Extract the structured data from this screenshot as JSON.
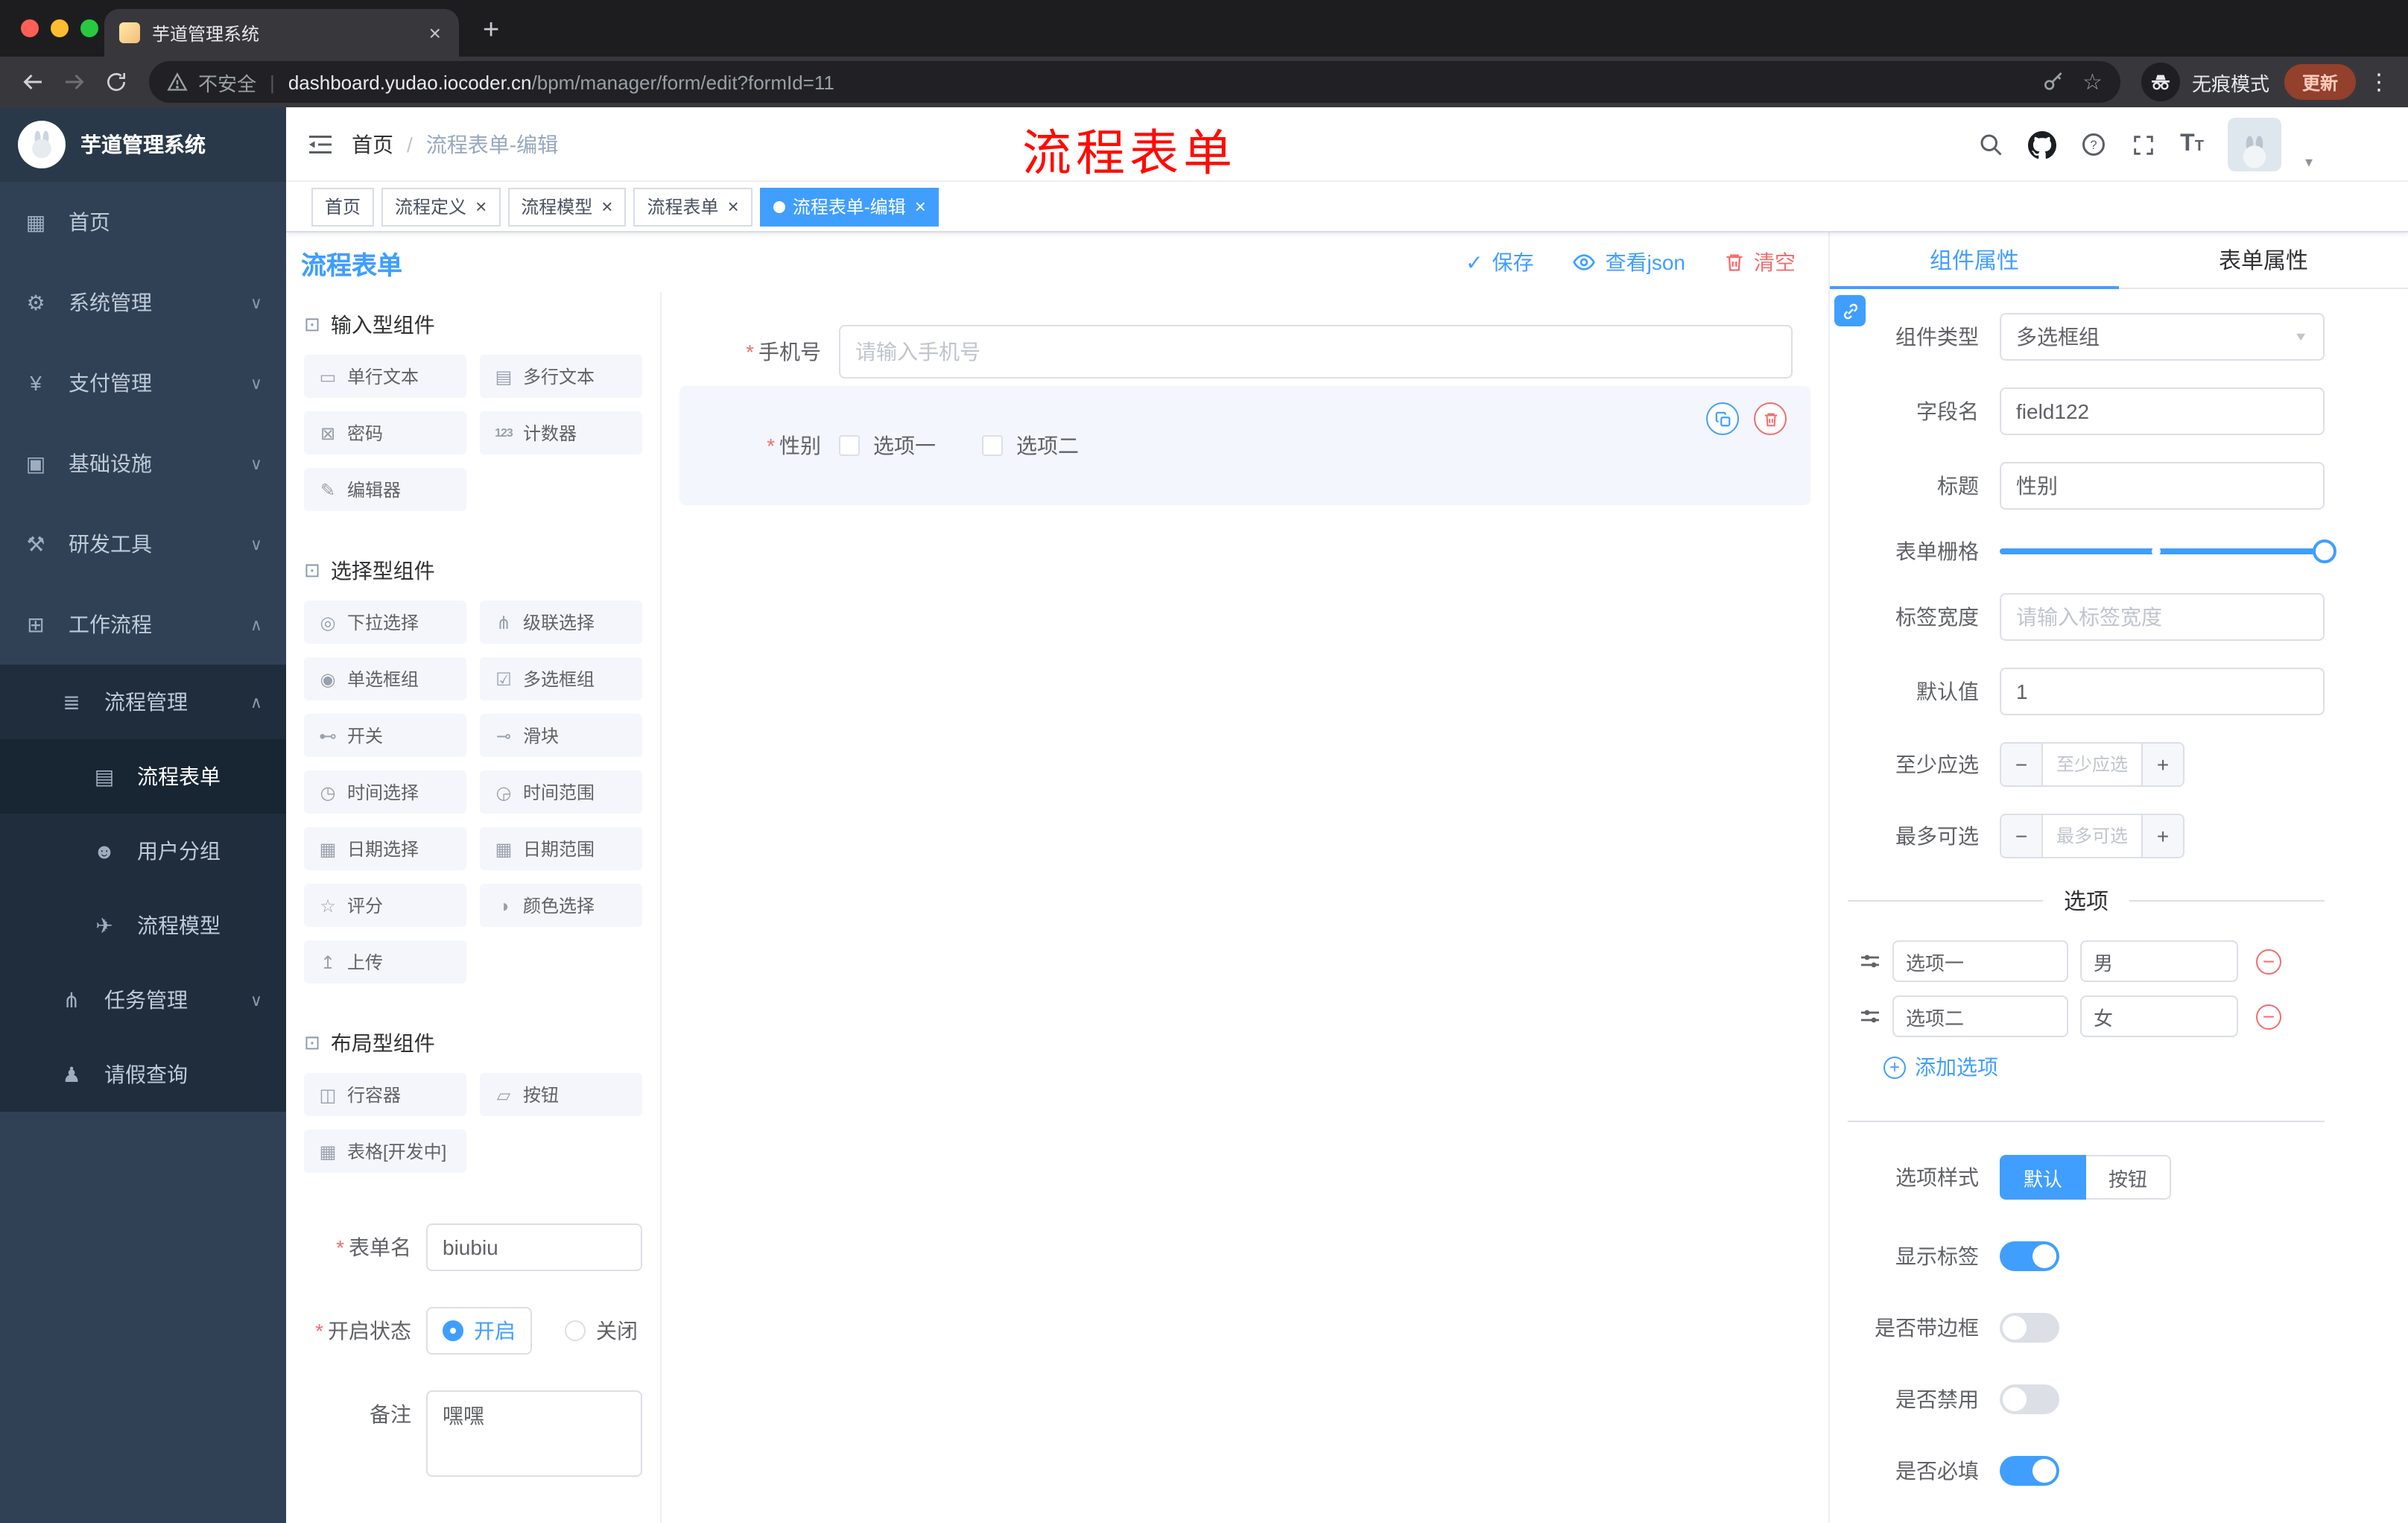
{
  "colors": {
    "accent": "#409EFF",
    "danger": "#F56C6C",
    "annotation_red": "#FF0000",
    "sidebar_bg": "#304156"
  },
  "browser": {
    "tab_title": "芋道管理系统",
    "new_tab": "+",
    "security": "不安全",
    "url_domain": "dashboard.yudao.iocoder.cn",
    "url_path": "/bpm/manager/form/edit?formId=11",
    "incognito": "无痕模式",
    "update": "更新"
  },
  "annotation": "流程表单",
  "sidebar": {
    "brand": "芋道管理系统",
    "menu": [
      {
        "label": "首页",
        "icon": "home",
        "level": 1
      },
      {
        "label": "系统管理",
        "icon": "gear",
        "level": 1,
        "chevron": "down"
      },
      {
        "label": "支付管理",
        "icon": "yen",
        "level": 1,
        "chevron": "down"
      },
      {
        "label": "基础设施",
        "icon": "infra",
        "level": 1,
        "chevron": "down"
      },
      {
        "label": "研发工具",
        "icon": "tools",
        "level": 1,
        "chevron": "down"
      },
      {
        "label": "工作流程",
        "icon": "workflow",
        "level": 1,
        "chevron": "up"
      },
      {
        "label": "流程管理",
        "icon": "list",
        "level": 2,
        "dark": true,
        "chevron": "up"
      },
      {
        "label": "流程表单",
        "icon": "form",
        "level": 3,
        "dark": true,
        "active": true
      },
      {
        "label": "用户分组",
        "icon": "users",
        "level": 3,
        "dark": true
      },
      {
        "label": "流程模型",
        "icon": "send",
        "level": 3,
        "dark": true
      },
      {
        "label": "任务管理",
        "icon": "tree",
        "level": 2,
        "dark": true,
        "chevron": "down"
      },
      {
        "label": "请假查询",
        "icon": "person",
        "level": 2,
        "dark": true
      }
    ]
  },
  "header": {
    "breadcrumb_home": "首页",
    "breadcrumb_sep": "/",
    "breadcrumb_current": "流程表单-编辑"
  },
  "tags": [
    {
      "label": "首页",
      "closable": false,
      "active": false
    },
    {
      "label": "流程定义",
      "closable": true,
      "active": false
    },
    {
      "label": "流程模型",
      "closable": true,
      "active": false
    },
    {
      "label": "流程表单",
      "closable": true,
      "active": false
    },
    {
      "label": "流程表单-编辑",
      "closable": true,
      "active": true
    }
  ],
  "designer": {
    "title": "流程表单",
    "actions": {
      "save": "保存",
      "view_json": "查看json",
      "clear": "清空"
    },
    "palette": [
      {
        "title": "输入型组件",
        "items": [
          {
            "label": "单行文本",
            "icon": "single-line"
          },
          {
            "label": "多行文本",
            "icon": "textarea"
          },
          {
            "label": "密码",
            "icon": "password"
          },
          {
            "label": "计数器",
            "icon": "counter"
          },
          {
            "label": "编辑器",
            "icon": "editor"
          }
        ]
      },
      {
        "title": "选择型组件",
        "items": [
          {
            "label": "下拉选择",
            "icon": "select"
          },
          {
            "label": "级联选择",
            "icon": "cascader"
          },
          {
            "label": "单选框组",
            "icon": "radio-group"
          },
          {
            "label": "多选框组",
            "icon": "checkbox-group"
          },
          {
            "label": "开关",
            "icon": "switch"
          },
          {
            "label": "滑块",
            "icon": "slider"
          },
          {
            "label": "时间选择",
            "icon": "time"
          },
          {
            "label": "时间范围",
            "icon": "time-range"
          },
          {
            "label": "日期选择",
            "icon": "date"
          },
          {
            "label": "日期范围",
            "icon": "date-range"
          },
          {
            "label": "评分",
            "icon": "rate"
          },
          {
            "label": "颜色选择",
            "icon": "color"
          },
          {
            "label": "上传",
            "icon": "upload"
          }
        ]
      },
      {
        "title": "布局型组件",
        "items": [
          {
            "label": "行容器",
            "icon": "row"
          },
          {
            "label": "按钮",
            "icon": "button"
          },
          {
            "label": "表格[开发中]",
            "icon": "table"
          }
        ]
      }
    ],
    "meta": {
      "name_label": "表单名",
      "name_value": "biubiu",
      "status_label": "开启状态",
      "status_on": "开启",
      "status_off": "关闭",
      "remark_label": "备注",
      "remark_value": "嘿嘿"
    },
    "canvas": {
      "phone_label": "手机号",
      "phone_placeholder": "请输入手机号",
      "gender_label": "性别",
      "gender_options": [
        "选项一",
        "选项二"
      ]
    }
  },
  "props": {
    "tab_component": "组件属性",
    "tab_form": "表单属性",
    "component_type_label": "组件类型",
    "component_type_value": "多选框组",
    "field_name_label": "字段名",
    "field_name_value": "field122",
    "title_label": "标题",
    "title_value": "性别",
    "grid_label": "表单栅格",
    "label_width_label": "标签宽度",
    "label_width_placeholder": "请输入标签宽度",
    "default_label": "默认值",
    "default_value": "1",
    "min_label": "至少应选",
    "min_placeholder": "至少应选",
    "max_label": "最多可选",
    "max_placeholder": "最多可选",
    "options_title": "选项",
    "options": [
      {
        "label": "选项一",
        "value": "男"
      },
      {
        "label": "选项二",
        "value": "女"
      }
    ],
    "add_option": "添加选项",
    "option_style_label": "选项样式",
    "option_style_default": "默认",
    "option_style_button": "按钮",
    "switches": [
      {
        "label": "显示标签",
        "on": true
      },
      {
        "label": "是否带边框",
        "on": false
      },
      {
        "label": "是否禁用",
        "on": false
      },
      {
        "label": "是否必填",
        "on": true
      }
    ]
  }
}
